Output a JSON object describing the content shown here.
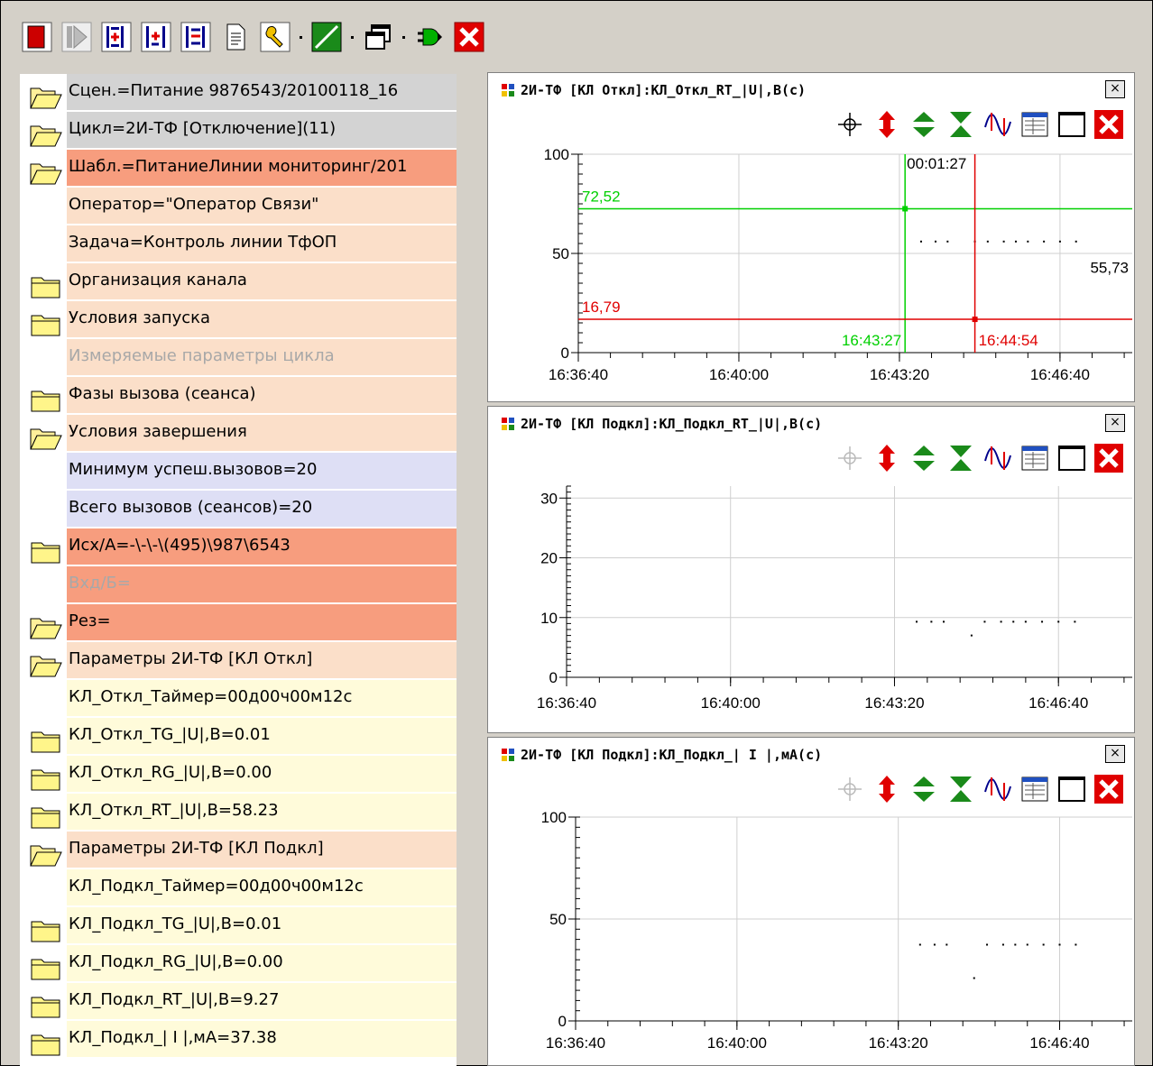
{
  "toolbar": {
    "buttons": [
      {
        "icon": "stop-icon",
        "color": "#cc0000"
      },
      {
        "icon": "play-disabled-icon"
      },
      {
        "icon": "insert-row-icon"
      },
      {
        "icon": "insert-child-icon"
      },
      {
        "icon": "delete-row-icon"
      },
      {
        "icon": "document-icon"
      },
      {
        "icon": "settings-wrench-icon"
      },
      {
        "icon": "line-chart-icon",
        "color": "#1a8a1a"
      },
      {
        "icon": "window-icon"
      },
      {
        "icon": "connect-plug-icon",
        "color": "#00a000"
      },
      {
        "icon": "close-icon",
        "color": "#e00000"
      }
    ]
  },
  "tree": {
    "rows": [
      {
        "label": "Сцен.=Питание  9876543/20100118_16",
        "icon": "folder-open-icon",
        "color": "gray"
      },
      {
        "label": "Цикл=2И-ТФ [Отключение](11)",
        "icon": "folder-open-icon",
        "color": "gray"
      },
      {
        "label": "Шабл.=ПитаниеЛинии  мониторинг/201",
        "icon": "folder-open-icon",
        "color": "salmon"
      },
      {
        "label": "Оператор=\"Оператор Связи\"",
        "icon": "",
        "color": "peach"
      },
      {
        "label": "Задача=Контроль линии ТфОП",
        "icon": "",
        "color": "peach"
      },
      {
        "label": "Организация канала",
        "icon": "folder-closed-icon",
        "color": "peach"
      },
      {
        "label": "Условия запуска",
        "icon": "folder-closed-icon",
        "color": "peach"
      },
      {
        "label": "Измеряемые параметры цикла",
        "icon": "",
        "color": "peach",
        "dim": true
      },
      {
        "label": "Фазы вызова (сеанса)",
        "icon": "folder-closed-icon",
        "color": "peach"
      },
      {
        "label": "Условия завершения",
        "icon": "folder-open-icon",
        "color": "peach"
      },
      {
        "label": "Минимум успеш.вызовов=20",
        "icon": "",
        "color": "lav"
      },
      {
        "label": "Всего вызовов (сеансов)=20",
        "icon": "",
        "color": "lav"
      },
      {
        "label": "Исх/А=-\\-\\-\\(495)\\987\\6543",
        "icon": "folder-closed-icon",
        "color": "salmon"
      },
      {
        "label": "Вхд/Б=",
        "icon": "",
        "color": "salmon",
        "dim": true
      },
      {
        "label": "Рез=",
        "icon": "folder-open-icon",
        "color": "salmon"
      },
      {
        "label": "Параметры 2И-ТФ [КЛ Откл]",
        "icon": "folder-open-icon",
        "color": "peach"
      },
      {
        "label": "КЛ_Откл_Таймер=00д00ч00м12с",
        "icon": "",
        "color": "yel"
      },
      {
        "label": "КЛ_Откл_TG_|U|,В=0.01",
        "icon": "folder-closed-icon",
        "color": "yel"
      },
      {
        "label": "КЛ_Откл_RG_|U|,В=0.00",
        "icon": "folder-closed-icon",
        "color": "yel"
      },
      {
        "label": "КЛ_Откл_RT_|U|,В=58.23",
        "icon": "folder-closed-icon",
        "color": "yel"
      },
      {
        "label": "Параметры 2И-ТФ [КЛ Подкл]",
        "icon": "folder-open-icon",
        "color": "peach"
      },
      {
        "label": "КЛ_Подкл_Таймер=00д00ч00м12с",
        "icon": "",
        "color": "yel"
      },
      {
        "label": "КЛ_Подкл_TG_|U|,В=0.01",
        "icon": "folder-closed-icon",
        "color": "yel"
      },
      {
        "label": "КЛ_Подкл_RG_|U|,В=0.00",
        "icon": "folder-closed-icon",
        "color": "yel"
      },
      {
        "label": "КЛ_Подкл_RT_|U|,В=9.27",
        "icon": "folder-closed-icon",
        "color": "yel"
      },
      {
        "label": "КЛ_Подкл_| I |,мА=37.38",
        "icon": "folder-closed-icon",
        "color": "yel"
      }
    ]
  },
  "panels": [
    {
      "title": "2И-ТФ [КЛ Откл]:КЛ_Откл_RT_|U|,В(с)",
      "close_label": "×",
      "crosshair_enabled": true
    },
    {
      "title": "2И-ТФ [КЛ Подкл]:КЛ_Подкл_RT_|U|,В(с)",
      "close_label": "×",
      "crosshair_enabled": false
    },
    {
      "title": "2И-ТФ [КЛ Подкл]:КЛ_Подкл_| I |,мА(с)",
      "close_label": "×",
      "crosshair_enabled": false
    }
  ],
  "chart_data": [
    {
      "type": "scatter",
      "ylim": [
        0,
        100
      ],
      "yticks": [
        "0",
        "50",
        "100"
      ],
      "xticks": [
        "16:36:40",
        "16:40:00",
        "16:43:20",
        "16:46:40"
      ],
      "x": [
        "16:43:47",
        "16:44:05",
        "16:44:20",
        "16:44:54",
        "16:45:10",
        "16:45:30",
        "16:45:45",
        "16:46:00",
        "16:46:20",
        "16:46:40",
        "16:47:00"
      ],
      "y": [
        56,
        56,
        56,
        56,
        56,
        56,
        56,
        56,
        56,
        56,
        56
      ],
      "cursors": [
        {
          "label_x": "16:43:27",
          "label_y": "72,52",
          "color": "#00d000",
          "y": 72.52
        },
        {
          "label_x": "16:44:54",
          "label_y": "16,79",
          "color": "#e00000",
          "y": 16.79
        }
      ],
      "delta_label": "00:01:27",
      "last_value_label": "55,73"
    },
    {
      "type": "scatter",
      "ylim": [
        0,
        32
      ],
      "yticks": [
        "0",
        "10",
        "20",
        "30"
      ],
      "xticks": [
        "16:36:40",
        "16:40:00",
        "16:43:20",
        "16:46:40"
      ],
      "x": [
        "16:43:47",
        "16:44:05",
        "16:44:20",
        "16:44:54",
        "16:45:10",
        "16:45:30",
        "16:45:45",
        "16:46:00",
        "16:46:20",
        "16:46:40",
        "16:47:00"
      ],
      "y": [
        9.3,
        9.3,
        9.3,
        7,
        9.3,
        9.3,
        9.3,
        9.3,
        9.3,
        9.3,
        9.3
      ]
    },
    {
      "type": "scatter",
      "ylim": [
        0,
        100
      ],
      "yticks": [
        "0",
        "50",
        "100"
      ],
      "xticks": [
        "16:36:40",
        "16:40:00",
        "16:43:20",
        "16:46:40"
      ],
      "x": [
        "16:43:47",
        "16:44:05",
        "16:44:20",
        "16:44:54",
        "16:45:10",
        "16:45:30",
        "16:45:45",
        "16:46:00",
        "16:46:20",
        "16:46:40",
        "16:47:00"
      ],
      "y": [
        37.4,
        37.4,
        37.4,
        21,
        37.4,
        37.4,
        37.4,
        37.4,
        37.4,
        37.4,
        37.4
      ]
    }
  ]
}
